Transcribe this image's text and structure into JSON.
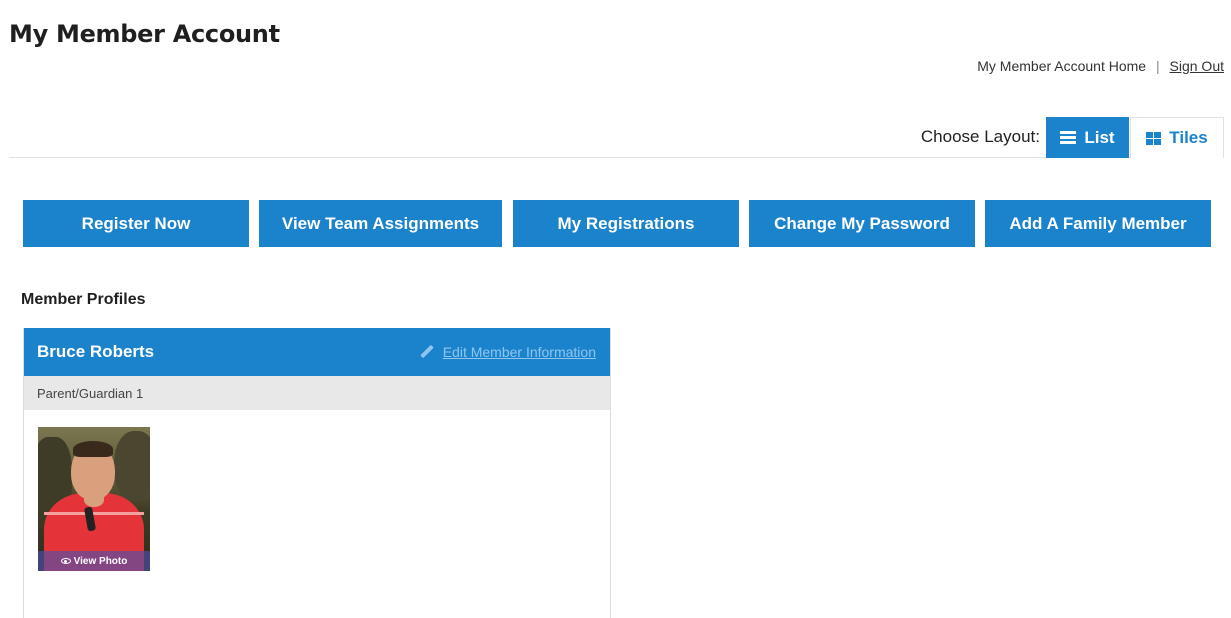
{
  "page": {
    "title": "My Member Account"
  },
  "top_links": {
    "home": "My Member Account Home",
    "separator": "|",
    "sign_out": "Sign Out"
  },
  "layout": {
    "label": "Choose Layout:",
    "options": [
      {
        "label": "List",
        "icon": "list-icon",
        "selected": true
      },
      {
        "label": "Tiles",
        "icon": "tiles-icon",
        "selected": false
      }
    ]
  },
  "actions": [
    {
      "label": "Register Now"
    },
    {
      "label": "View Team Assignments"
    },
    {
      "label": "My Registrations"
    },
    {
      "label": "Change My Password"
    },
    {
      "label": "Add A Family Member"
    }
  ],
  "profiles_section": {
    "title": "Member Profiles",
    "profiles": [
      {
        "name": "Bruce Roberts",
        "edit_label": "Edit Member Information",
        "edit_icon": "pencil-icon",
        "role": "Parent/Guardian 1",
        "photo_label": "View Photo",
        "photo_icon": "eye-icon"
      }
    ]
  },
  "colors": {
    "accent": "#1b82cc",
    "role_bar": "#e8e8e8",
    "edit_link": "#8fc6ef"
  }
}
